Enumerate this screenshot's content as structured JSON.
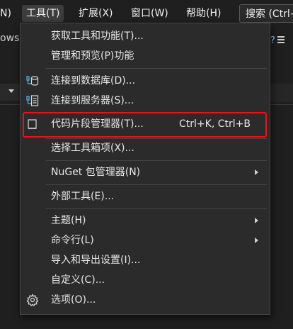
{
  "menubar": {
    "items": [
      {
        "label": "N)"
      },
      {
        "label": "工具(T)"
      },
      {
        "label": "扩展(X)"
      },
      {
        "label": "窗口(W)"
      },
      {
        "label": "帮助(H)"
      }
    ],
    "search_label": "搜索 (Ctrl+"
  },
  "background": {
    "text": "ows i"
  },
  "dropdown": {
    "items": [
      {
        "label": "获取工具和功能(T)...",
        "icon": "none"
      },
      {
        "label": "管理和预览(P)功能",
        "icon": "none"
      },
      {
        "label": "连接到数据库(D)...",
        "icon": "database-connect-icon"
      },
      {
        "label": "连接到服务器(S)...",
        "icon": "server-connect-icon"
      },
      {
        "label": "代码片段管理器(T)...",
        "shortcut": "Ctrl+K, Ctrl+B",
        "icon": "snippet-icon"
      },
      {
        "label": "选择工具箱项(X)...",
        "icon": "none"
      },
      {
        "label": "NuGet 包管理器(N)",
        "icon": "none",
        "submenu": true
      },
      {
        "label": "外部工具(E)...",
        "icon": "none"
      },
      {
        "label": "主题(H)",
        "icon": "none",
        "submenu": true
      },
      {
        "label": "命令行(L)",
        "icon": "none",
        "submenu": true
      },
      {
        "label": "导入和导出设置(I)...",
        "icon": "none"
      },
      {
        "label": "自定义(C)...",
        "icon": "none"
      },
      {
        "label": "选项(O)...",
        "icon": "gear-icon"
      }
    ]
  },
  "colors": {
    "menu_bg": "#2b2b2b",
    "highlight_border": "#e8121c",
    "icon_blue": "#4fb3e8",
    "active_menu_bg": "#3d3d3d"
  }
}
